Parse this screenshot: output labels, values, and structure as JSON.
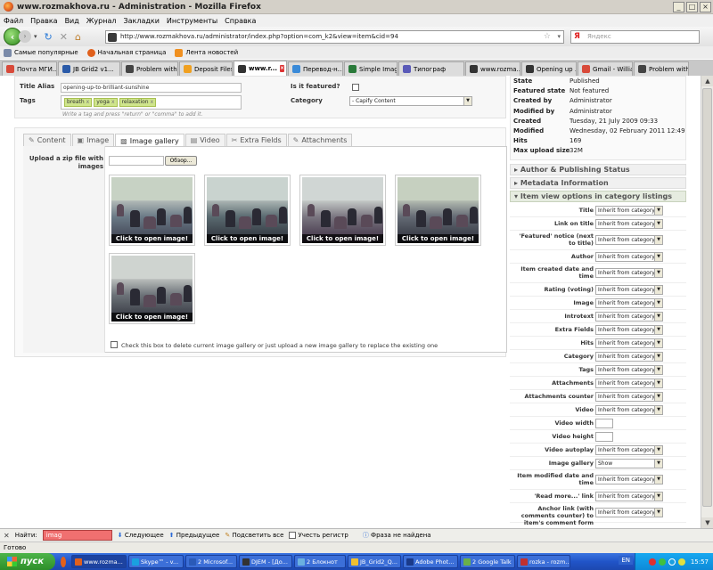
{
  "window": {
    "title": "www.rozmakhova.ru - Administration - Mozilla Firefox",
    "controls": [
      "_",
      "□",
      "×"
    ]
  },
  "menu": [
    "Файл",
    "Правка",
    "Вид",
    "Журнал",
    "Закладки",
    "Инструменты",
    "Справка"
  ],
  "nav": {
    "url": "http://www.rozmakhova.ru/administrator/index.php?option=com_k2&view=item&cid=94",
    "search_placeholder": "Яндекс",
    "search_engine": "Я"
  },
  "bookmarks": [
    "Самые популярные",
    "Начальная страница",
    "Лента новостей"
  ],
  "tabs": [
    {
      "label": "Почта МГИ...",
      "color": "#d84a3a"
    },
    {
      "label": "JB Grid2 v1...",
      "color": "#2a5aa8"
    },
    {
      "label": "Problem with...",
      "color": "#444444"
    },
    {
      "label": "Deposit Files",
      "color": "#f0a020"
    },
    {
      "label": "www.r...",
      "color": "#333333",
      "active": true
    },
    {
      "label": "Перевод-н...",
      "color": "#3a8ad8"
    },
    {
      "label": "Simple Imag...",
      "color": "#2a7a3a"
    },
    {
      "label": "Типограф",
      "color": "#5a5ab8"
    },
    {
      "label": "www.rozma...",
      "color": "#333333"
    },
    {
      "label": "Opening up ...",
      "color": "#333333"
    },
    {
      "label": "Gmail - Willia...",
      "color": "#d84a3a"
    },
    {
      "label": "Problem with...",
      "color": "#444444"
    }
  ],
  "form": {
    "title_alias_label": "Title Alias",
    "title_alias_value": "opening-up-to-brilliant-sunshine",
    "tags_label": "Tags",
    "tags": [
      "breath",
      "yoga",
      "relaxation"
    ],
    "tags_hint": "Write a tag and press \"return\" or \"comma\" to add it.",
    "featured_label": "Is it featured?",
    "category_label": "Category",
    "category_value": "- Capify Content"
  },
  "content_tabs": [
    {
      "label": "Content",
      "icon": "✎"
    },
    {
      "label": "Image",
      "icon": "▣"
    },
    {
      "label": "Image gallery",
      "icon": "▩",
      "active": true
    },
    {
      "label": "Video",
      "icon": "▤"
    },
    {
      "label": "Extra Fields",
      "icon": "✂"
    },
    {
      "label": "Attachments",
      "icon": "✎"
    }
  ],
  "gallery": {
    "upload_label": "Upload a zip file with images",
    "browse_label": "Обзор...",
    "caption": "Click to open image!",
    "delete_note": "Check this box to delete current image gallery or just upload a new image gallery to replace the existing one"
  },
  "info": [
    {
      "k": "State",
      "v": "Published"
    },
    {
      "k": "Featured state",
      "v": "Not featured"
    },
    {
      "k": "Created by",
      "v": "Administrator"
    },
    {
      "k": "Modified by",
      "v": "Administrator"
    },
    {
      "k": "Created",
      "v": "Tuesday, 21 July 2009 09:33"
    },
    {
      "k": "Modified",
      "v": "Wednesday, 02 February 2011 12:49"
    },
    {
      "k": "Hits",
      "v": "169"
    },
    {
      "k": "Max upload size",
      "v": "32M"
    }
  ],
  "sections": {
    "author": "Author & Publishing Status",
    "metadata": "Metadata Information",
    "options": "Item view options in category listings"
  },
  "options": [
    {
      "label": "Title",
      "value": "Inherit from category"
    },
    {
      "label": "Link on title",
      "value": "Inherit from category"
    },
    {
      "label": "'Featured' notice (next to title)",
      "value": "Inherit from category"
    },
    {
      "label": "Author",
      "value": "Inherit from category"
    },
    {
      "label": "Item created date and time",
      "value": "Inherit from category"
    },
    {
      "label": "Rating (voting)",
      "value": "Inherit from category"
    },
    {
      "label": "Image",
      "value": "Inherit from category"
    },
    {
      "label": "Introtext",
      "value": "Inherit from category"
    },
    {
      "label": "Extra Fields",
      "value": "Inherit from category"
    },
    {
      "label": "Hits",
      "value": "Inherit from category"
    },
    {
      "label": "Category",
      "value": "Inherit from category"
    },
    {
      "label": "Tags",
      "value": "Inherit from category"
    },
    {
      "label": "Attachments",
      "value": "Inherit from category"
    },
    {
      "label": "Attachments counter",
      "value": "Inherit from category"
    },
    {
      "label": "Video",
      "value": "Inherit from category"
    },
    {
      "label": "Video width",
      "value": ""
    },
    {
      "label": "Video height",
      "value": ""
    },
    {
      "label": "Video autoplay",
      "value": "Inherit from category"
    },
    {
      "label": "Image gallery",
      "value": "Show"
    },
    {
      "label": "Item modified date and time",
      "value": "Inherit from category"
    },
    {
      "label": "'Read more...' link",
      "value": "Inherit from category"
    },
    {
      "label": "Anchor link (with comments counter) to item's comment form",
      "value": "Inherit from category"
    }
  ],
  "findbar": {
    "label": "Найти:",
    "value": "imag",
    "next": "Следующее",
    "prev": "Предыдущее",
    "highlight": "Подсветить все",
    "matchcase": "Учесть регистр",
    "status": "Фраза не найдена"
  },
  "status": "Готово",
  "taskbar": {
    "start": "пуск",
    "tasks": [
      {
        "label": "www.rozma...",
        "color": "#e0601c",
        "active": true
      },
      {
        "label": "Skype™ - v...",
        "color": "#1aa0e0"
      },
      {
        "label": "2 Microsof...",
        "color": "#2a5ab8"
      },
      {
        "label": "DJEM - [До...",
        "color": "#333333"
      },
      {
        "label": "2 Блокнот",
        "color": "#6ab0e0"
      },
      {
        "label": "JB_Grid2_Q...",
        "color": "#f0c030"
      },
      {
        "label": "Adobe Phot...",
        "color": "#1a3a8a"
      },
      {
        "label": "2 Google Talk",
        "color": "#6ab04a"
      },
      {
        "label": "rozka - rozm...",
        "color": "#c03030"
      }
    ],
    "lang": "EN",
    "time": "15:57"
  }
}
